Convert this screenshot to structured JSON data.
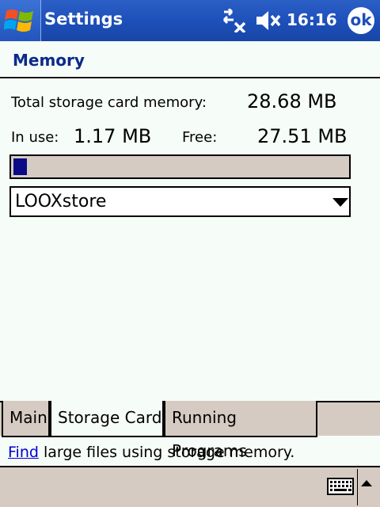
{
  "titlebar": {
    "app_title": "Settings",
    "clock": "16:16",
    "ok_label": "ok",
    "start_icon": "windows-flag-icon",
    "connectivity_icon": "connectivity-icon",
    "volume_icon": "volume-muted-icon"
  },
  "page": {
    "title": "Memory"
  },
  "memory": {
    "total_label": "Total storage card memory:",
    "total_value": "28.68 MB",
    "in_use_label": "In use:",
    "in_use_value": "1.17 MB",
    "free_label": "Free:",
    "free_value": "27.51 MB",
    "usage_fraction": 0.041,
    "bar_color": "#0a0a86"
  },
  "card_select": {
    "selected": "LOOXstore"
  },
  "tabs": [
    {
      "label": "Main",
      "active": false
    },
    {
      "label": "Storage Card",
      "active": true
    },
    {
      "label": "Running Programs",
      "active": false
    }
  ],
  "footer": {
    "link_text": "Find",
    "rest_text": " large files using storage memory."
  },
  "menubar": {
    "keyboard_icon": "keyboard-icon",
    "sip_icon": "up-arrow-icon"
  },
  "colors": {
    "titlebar": "#1d4fb8",
    "page_title": "#0b2a8c",
    "tab_background": "#d6cbc2"
  }
}
